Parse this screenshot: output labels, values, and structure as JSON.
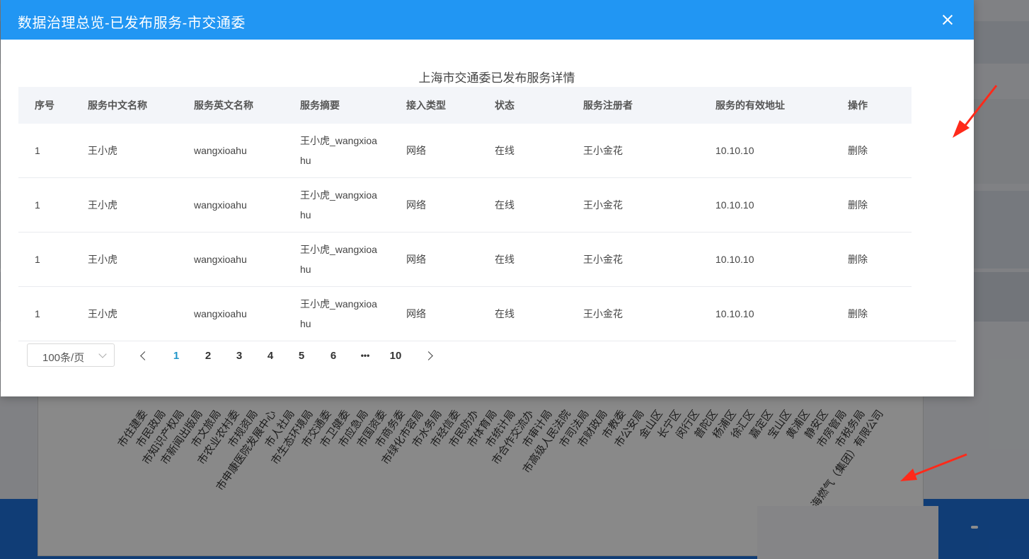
{
  "modal": {
    "title": "数据治理总览-已发布服务-市交通委",
    "caption": "上海市交通委已发布服务详情"
  },
  "table": {
    "headers": [
      "序号",
      "服务中文名称",
      "服务英文名称",
      "服务摘要",
      "接入类型",
      "状态",
      "服务注册者",
      "服务的有效地址",
      "操作"
    ],
    "rows": [
      {
        "index": "1",
        "cn_name": "王小虎",
        "en_name": "wangxioahu",
        "summary": "王小虎_wangxioahu",
        "type": "网络",
        "status": "在线",
        "registrant": "王小金花",
        "address": "10.10.10",
        "action": "删除"
      },
      {
        "index": "1",
        "cn_name": "王小虎",
        "en_name": "wangxioahu",
        "summary": "王小虎_wangxioahu",
        "type": "网络",
        "status": "在线",
        "registrant": "王小金花",
        "address": "10.10.10",
        "action": "删除"
      },
      {
        "index": "1",
        "cn_name": "王小虎",
        "en_name": "wangxioahu",
        "summary": "王小虎_wangxioahu",
        "type": "网络",
        "status": "在线",
        "registrant": "王小金花",
        "address": "10.10.10",
        "action": "删除"
      },
      {
        "index": "1",
        "cn_name": "王小虎",
        "en_name": "wangxioahu",
        "summary": "王小虎_wangxioahu",
        "type": "网络",
        "status": "在线",
        "registrant": "王小金花",
        "address": "10.10.10",
        "action": "删除"
      }
    ]
  },
  "pagination": {
    "page_size": "100条/页",
    "pages": [
      "1",
      "2",
      "3",
      "4",
      "5",
      "6",
      "•••",
      "10"
    ],
    "current": "1"
  },
  "background": {
    "rotated_labels": [
      "市住建委",
      "市民政局",
      "市知识产权局",
      "市新闻出版局",
      "市文旅局",
      "市农业农村委",
      "市规资局",
      "市申康医院发展中心",
      "市人社局",
      "市生态环境局",
      "市交通委",
      "市卫健委",
      "市应急局",
      "市国资委",
      "市商务委",
      "市绿化市容局",
      "市水务局",
      "市经信委",
      "市民防办",
      "市体育局",
      "市统计局",
      "市合作交流办",
      "市审计局",
      "市高级人民法院",
      "市司法局",
      "市财政局",
      "市教委",
      "市公安局",
      "金山区",
      "长宁区",
      "闵行区",
      "普陀区",
      "杨浦区",
      "徐汇区",
      "嘉定区",
      "宝山区",
      "黄浦区",
      "静安区",
      "市房管局",
      "市税务局",
      "海燃气（集团）有限公司"
    ]
  },
  "colors": {
    "header_bg": "#2196f3",
    "active_page": "#2196c9",
    "annotation": "#ff2a1a"
  }
}
